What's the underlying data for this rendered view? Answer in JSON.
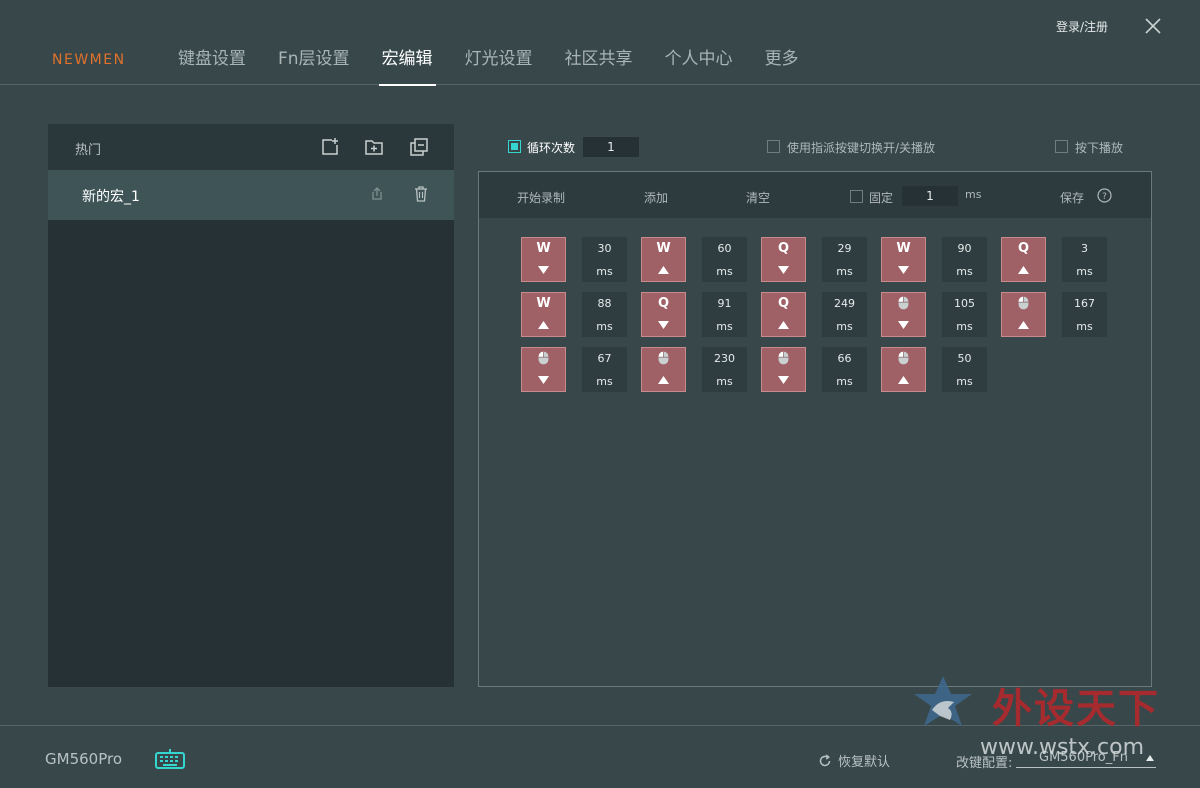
{
  "app": {
    "logo_text": "NEWMEN",
    "login_label": "登录/注册"
  },
  "nav": {
    "tabs": [
      {
        "label": "键盘设置",
        "active": false
      },
      {
        "label": "Fn层设置",
        "active": false
      },
      {
        "label": "宏编辑",
        "active": true
      },
      {
        "label": "灯光设置",
        "active": false
      },
      {
        "label": "社区共享",
        "active": false
      },
      {
        "label": "个人中心",
        "active": false
      },
      {
        "label": "更多",
        "active": false
      }
    ]
  },
  "macro_list": {
    "header_title": "热门",
    "items": [
      {
        "name": "新的宏_1",
        "selected": true
      }
    ]
  },
  "options": {
    "loop_label": "循环次数",
    "loop_checked": true,
    "loop_count": "1",
    "assign_toggle_label": "使用指派按键切换开/关播放",
    "assign_toggle_checked": false,
    "press_play_label": "按下播放",
    "press_play_checked": false
  },
  "toolbar": {
    "record_label": "开始录制",
    "add_label": "添加",
    "clear_label": "清空",
    "fixed_label": "固定",
    "fixed_checked": false,
    "fixed_value": "1",
    "fixed_unit": "ms",
    "save_label": "保存"
  },
  "macro_events": [
    {
      "type": "key",
      "key": "W",
      "action": "down",
      "delay": "30",
      "unit": "ms"
    },
    {
      "type": "key",
      "key": "W",
      "action": "up",
      "delay": "60",
      "unit": "ms"
    },
    {
      "type": "key",
      "key": "Q",
      "action": "down",
      "delay": "29",
      "unit": "ms"
    },
    {
      "type": "key",
      "key": "W",
      "action": "down",
      "delay": "90",
      "unit": "ms"
    },
    {
      "type": "key",
      "key": "Q",
      "action": "up",
      "delay": "3",
      "unit": "ms"
    },
    {
      "type": "key",
      "key": "W",
      "action": "up",
      "delay": "88",
      "unit": "ms"
    },
    {
      "type": "key",
      "key": "Q",
      "action": "down",
      "delay": "91",
      "unit": "ms"
    },
    {
      "type": "key",
      "key": "Q",
      "action": "up",
      "delay": "249",
      "unit": "ms"
    },
    {
      "type": "mouse",
      "key": "",
      "action": "down",
      "delay": "105",
      "unit": "ms"
    },
    {
      "type": "mouse",
      "key": "",
      "action": "up",
      "delay": "167",
      "unit": "ms"
    },
    {
      "type": "mouse",
      "key": "",
      "action": "down",
      "delay": "67",
      "unit": "ms"
    },
    {
      "type": "mouse",
      "key": "",
      "action": "up",
      "delay": "230",
      "unit": "ms"
    },
    {
      "type": "mouse",
      "key": "",
      "action": "down",
      "delay": "66",
      "unit": "ms"
    },
    {
      "type": "mouse",
      "key": "",
      "action": "up",
      "delay": "50",
      "unit": "ms"
    }
  ],
  "footer": {
    "device_name": "GM560Pro",
    "reset_label": "恢复默认",
    "config_label": "改键配置:",
    "config_value": "GM560Pro_Fn"
  },
  "watermark": {
    "text_cn": "外设天下",
    "url": "www.wstx.com"
  },
  "colors": {
    "accent": "#34d6cf",
    "brand": "#e0722c",
    "key_block": "#a06166",
    "background": "#37474a"
  }
}
